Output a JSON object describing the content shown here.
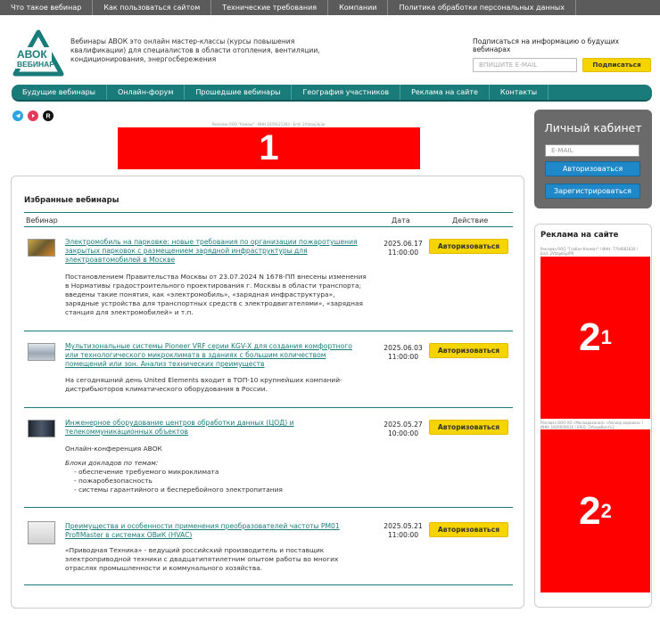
{
  "topnav": [
    "Что такое вебинар",
    "Как пользоваться сайтом",
    "Технические требования",
    "Компании",
    "Политика обработки персональных данных"
  ],
  "logo": {
    "line1": "АВОК",
    "line2": "ВЕБИНАР"
  },
  "tagline": "Вебинары АВОК это онлайн мастер-классы (курсы повышения квалификации) для специалистов в области отопления, вентиляции, кондиционирования, энергосбережения",
  "subscribe": {
    "title": "Подписаться на информацию о будущих вебинарах",
    "placeholder": "ВПИШИТЕ E-MAIL",
    "button": "Подписаться"
  },
  "mainnav": [
    "Будущие вебинары",
    "Онлайн-форум",
    "Прошедшие вебинары",
    "География участников",
    "Реклама на сайте",
    "Контакты"
  ],
  "social": [
    "telegram-icon",
    "youtube-icon",
    "rutube-icon"
  ],
  "ad1": {
    "caption": "Реклама ООО \"Комаш\" · ИНН 1659121283 · Erid: 2Vtzquj3p3p",
    "label": "1"
  },
  "favorites": {
    "title": "Избранные вебинары",
    "col_webinar": "Вебинар",
    "col_date": "Дата",
    "col_action": "Действие",
    "rows": [
      {
        "title": "Электромобиль на парковке: новые требования по организации пожаротушения закрытых парковок с размещением зарядной инфраструктуры для электроавтомобилей в Москве",
        "date": "2025.06.17",
        "time": "11:00:00",
        "action": "Авторизоваться",
        "desc": "Постановлением Правительства Москвы от 23.07.2024 N 1678-ПП внесены изменения в Нормативы градостроительного проектирования г. Москвы в области транспорта; введены такие понятия, как «электромобиль», «зарядная инфраструктура», зарядные устройства для транспортных средств с электродвигателями», «зарядная станция для электромобилей» и т.п."
      },
      {
        "title": "Мультизональные системы Pioneer VRF серии KGV-X для создания комфортного или технологического микроклимата в зданиях с большим количеством помещений или зон. Анализ технических преимуществ",
        "date": "2025.06.03",
        "time": "11:00:00",
        "action": "Авторизоваться",
        "desc": "На сегодняшний день United Elements входит в ТОП-10 крупнейших компаний-дистрибьюторов климатического оборудования в России."
      },
      {
        "title": "Инженерное оборудование центров обработки данных (ЦОД) и телекоммуникационных объектов",
        "date": "2025.05.27",
        "time": "10:00:00",
        "action": "Авторизоваться",
        "desc": "Онлайн-конференция АВОК",
        "desc_italic": "Блоки докладов по темам:",
        "desc_items": [
          "- обеспечение требуемого микроклимата",
          "- пожаробезопасность",
          "- системы гарантийного и бесперебойного электропитания"
        ]
      },
      {
        "title": "Преимущества и особенности применения преобразователей частоты PM01 ProfiMaster в системах ОВиК (HVAC)",
        "date": "2025.05.21",
        "time": "11:00:00",
        "action": "Авторизоваться",
        "desc": "«Приводная Техника» - ведущий российский производитель и поставщик электроприводной техники с двадцатипятилетним опытом работы во многих отраслях промышленности и коммунального хозяйства."
      }
    ]
  },
  "cabinet": {
    "title": "Личный кабинет",
    "placeholder": "E-MAIL",
    "login": "Авторизоваться",
    "register": "Зарегистрироваться"
  },
  "ads_right": {
    "title": "Реклама на сайте",
    "ad1_caption": "Реклама ООО \"Глобал Климат\" / ИНН: 7704681630 / Erid: 2VtzqwSyzPR",
    "ad1_label": "2",
    "ad1_sub": "1",
    "ad2_caption": "Реклама ООО АО «Мосводоканал» «Аксиор водника» / ИНН: 1826000616 / ERID: 2VtzqwBxnYv2",
    "ad2_label": "2",
    "ad2_sub": "2"
  },
  "colors": {
    "teal": "#1a7c7a",
    "yellow": "#f6d400",
    "ad_red": "#ff0000",
    "topnav_bg": "#5b5b5b"
  }
}
